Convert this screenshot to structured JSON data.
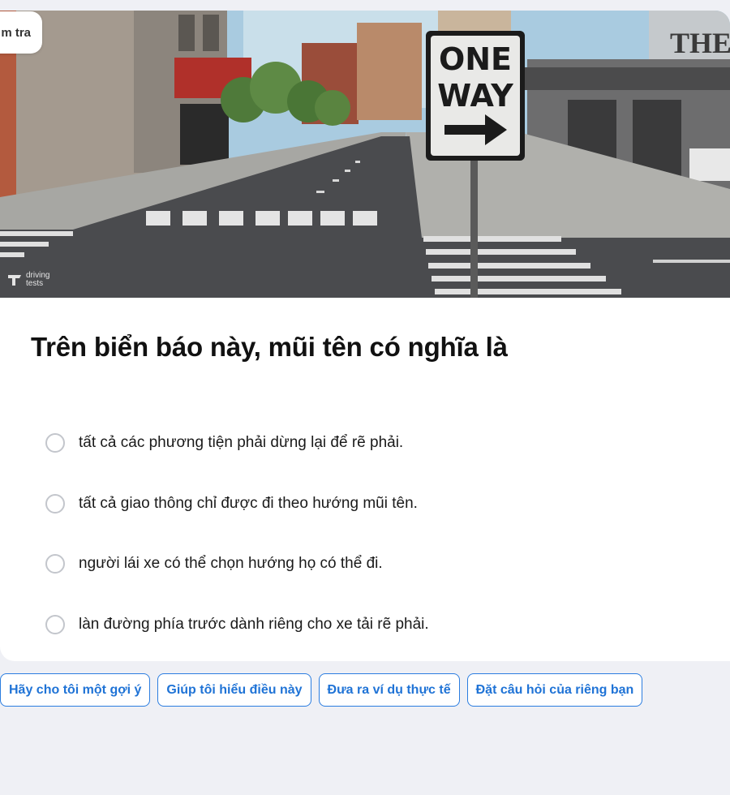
{
  "header": {
    "pill_label": "m tra"
  },
  "hero": {
    "sign_line1": "ONE",
    "sign_line2": "WAY",
    "watermark_line1": "driving",
    "watermark_line2": "tests",
    "building_text": "THE"
  },
  "question": {
    "title": "Trên biển báo này, mũi tên có nghĩa là"
  },
  "options": [
    "tất cả các phương tiện phải dừng lại để rẽ phải.",
    "tất cả giao thông chỉ được đi theo hướng mũi tên.",
    "người lái xe có thể chọn hướng họ có thể đi.",
    "làn đường phía trước dành riêng cho xe tải rẽ phải."
  ],
  "chips": [
    "Hãy cho tôi một gợi ý",
    "Giúp tôi hiểu điều này",
    "Đưa ra ví dụ thực tế",
    "Đặt câu hỏi của riêng bạn"
  ],
  "colors": {
    "accent": "#2b7de0",
    "background": "#eff0f5"
  }
}
